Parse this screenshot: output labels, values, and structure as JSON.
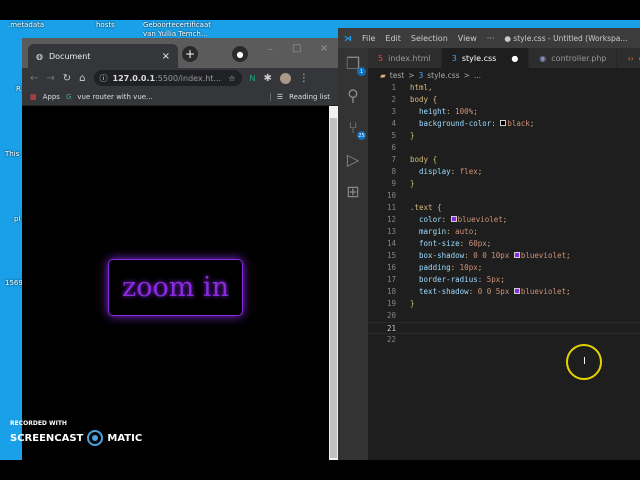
{
  "desktop": {
    "icons": [
      ".metadata",
      "hosts",
      "Geboortecertificaat van Yullia Temch..."
    ],
    "edge_labels": [
      "R",
      "This",
      "pl",
      "1569"
    ]
  },
  "chrome": {
    "tab_title": "Document",
    "new_tab": "+",
    "url_host": "127.0.0.1",
    "url_rest": ":5500/index.ht...",
    "bookmarks": [
      "Apps",
      "vue router with vue..."
    ],
    "reading_list": "Reading list",
    "page_text": "zoom in",
    "page_text_color": "#8a2be2"
  },
  "vscode": {
    "menu": [
      "File",
      "Edit",
      "Selection",
      "View",
      "···"
    ],
    "title": "● style.css - Untitled (Workspa...",
    "tabs": [
      "index.html",
      "style.css",
      "controller.php",
      "db"
    ],
    "breadcrumb": [
      "test",
      ">",
      "style.css",
      ">",
      "..."
    ],
    "badges": {
      "explorer": "1",
      "scm": "25"
    },
    "lines": [
      {
        "n": "1",
        "code": "html,"
      },
      {
        "n": "2",
        "code": "body {"
      },
      {
        "n": "3",
        "prop": "height",
        "val": "100%"
      },
      {
        "n": "4",
        "prop": "background-color",
        "swatch": "#000000",
        "val": "black"
      },
      {
        "n": "5",
        "code": "}"
      },
      {
        "n": "6",
        "code": ""
      },
      {
        "n": "7",
        "code": "body {"
      },
      {
        "n": "8",
        "prop": "display",
        "val": "flex"
      },
      {
        "n": "9",
        "code": "}"
      },
      {
        "n": "10",
        "code": ""
      },
      {
        "n": "11",
        "code": ".text {"
      },
      {
        "n": "12",
        "prop": "color",
        "swatch": "#8a2be2",
        "val": "blueviolet"
      },
      {
        "n": "13",
        "prop": "margin",
        "val": "auto"
      },
      {
        "n": "14",
        "prop": "font-size",
        "val": "60px"
      },
      {
        "n": "15",
        "prop": "box-shadow",
        "pre": "0 0 10px",
        "swatch": "#8a2be2",
        "val": "blueviolet"
      },
      {
        "n": "16",
        "prop": "padding",
        "val": "10px"
      },
      {
        "n": "17",
        "prop": "border-radius",
        "val": "5px"
      },
      {
        "n": "18",
        "prop": "text-shadow",
        "pre": "0 0 5px",
        "swatch": "#8a2be2",
        "val": "blueviolet"
      },
      {
        "n": "19",
        "code": "}"
      },
      {
        "n": "20",
        "code": ""
      },
      {
        "n": "21",
        "code": ""
      },
      {
        "n": "22",
        "code": ""
      }
    ]
  },
  "watermark": {
    "line1": "RECORDED WITH",
    "line2a": "SCREENCAST",
    "line2b": "MATIC"
  },
  "cursor_glyph": "I"
}
